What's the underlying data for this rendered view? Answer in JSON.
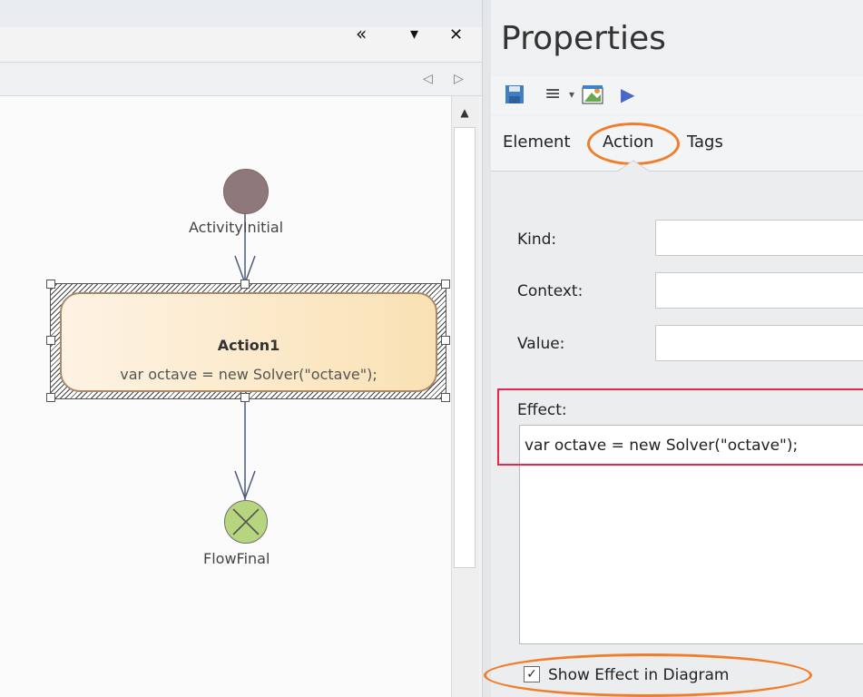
{
  "diagram_pane": {
    "header_icons": [
      "collapse-left-icon",
      "dropdown-arrow-icon",
      "close-icon"
    ],
    "header_glyphs": {
      "collapse": "«",
      "dropdown": "▾",
      "close": "✕"
    },
    "nav_glyphs": {
      "prev": "◁",
      "next": "▷"
    },
    "scroll_up_glyph": "▲",
    "nodes": {
      "initial_label": "ActivityInitial",
      "action_name": "Action1",
      "action_effect": "var octave = new Solver(\"octave\");",
      "final_label": "FlowFinal"
    }
  },
  "properties": {
    "title": "Properties",
    "toolbar_icons": [
      "save-icon",
      "list-menu-icon",
      "dropdown-icon",
      "palette-icon",
      "play-icon"
    ],
    "toolbar_glyphs": {
      "menu": "≡",
      "dropdown": "▾",
      "play": "▶"
    },
    "tabs": [
      {
        "label": "Element"
      },
      {
        "label": "Action",
        "active": true
      },
      {
        "label": "Tags"
      }
    ],
    "fields": {
      "kind_label": "Kind:",
      "context_label": "Context:",
      "value_label": "Value:",
      "effect_label": "Effect:",
      "effect_value": "var octave = new Solver(\"octave\");"
    },
    "checkbox": {
      "checked": true,
      "glyph": "✓",
      "label": "Show Effect in Diagram"
    }
  },
  "colors": {
    "highlight_orange": "#f07d2a",
    "highlight_red": "#e8264e",
    "action_fill": "#fae1b4",
    "initial_fill": "#8e7879",
    "final_fill": "#b7d47f"
  }
}
